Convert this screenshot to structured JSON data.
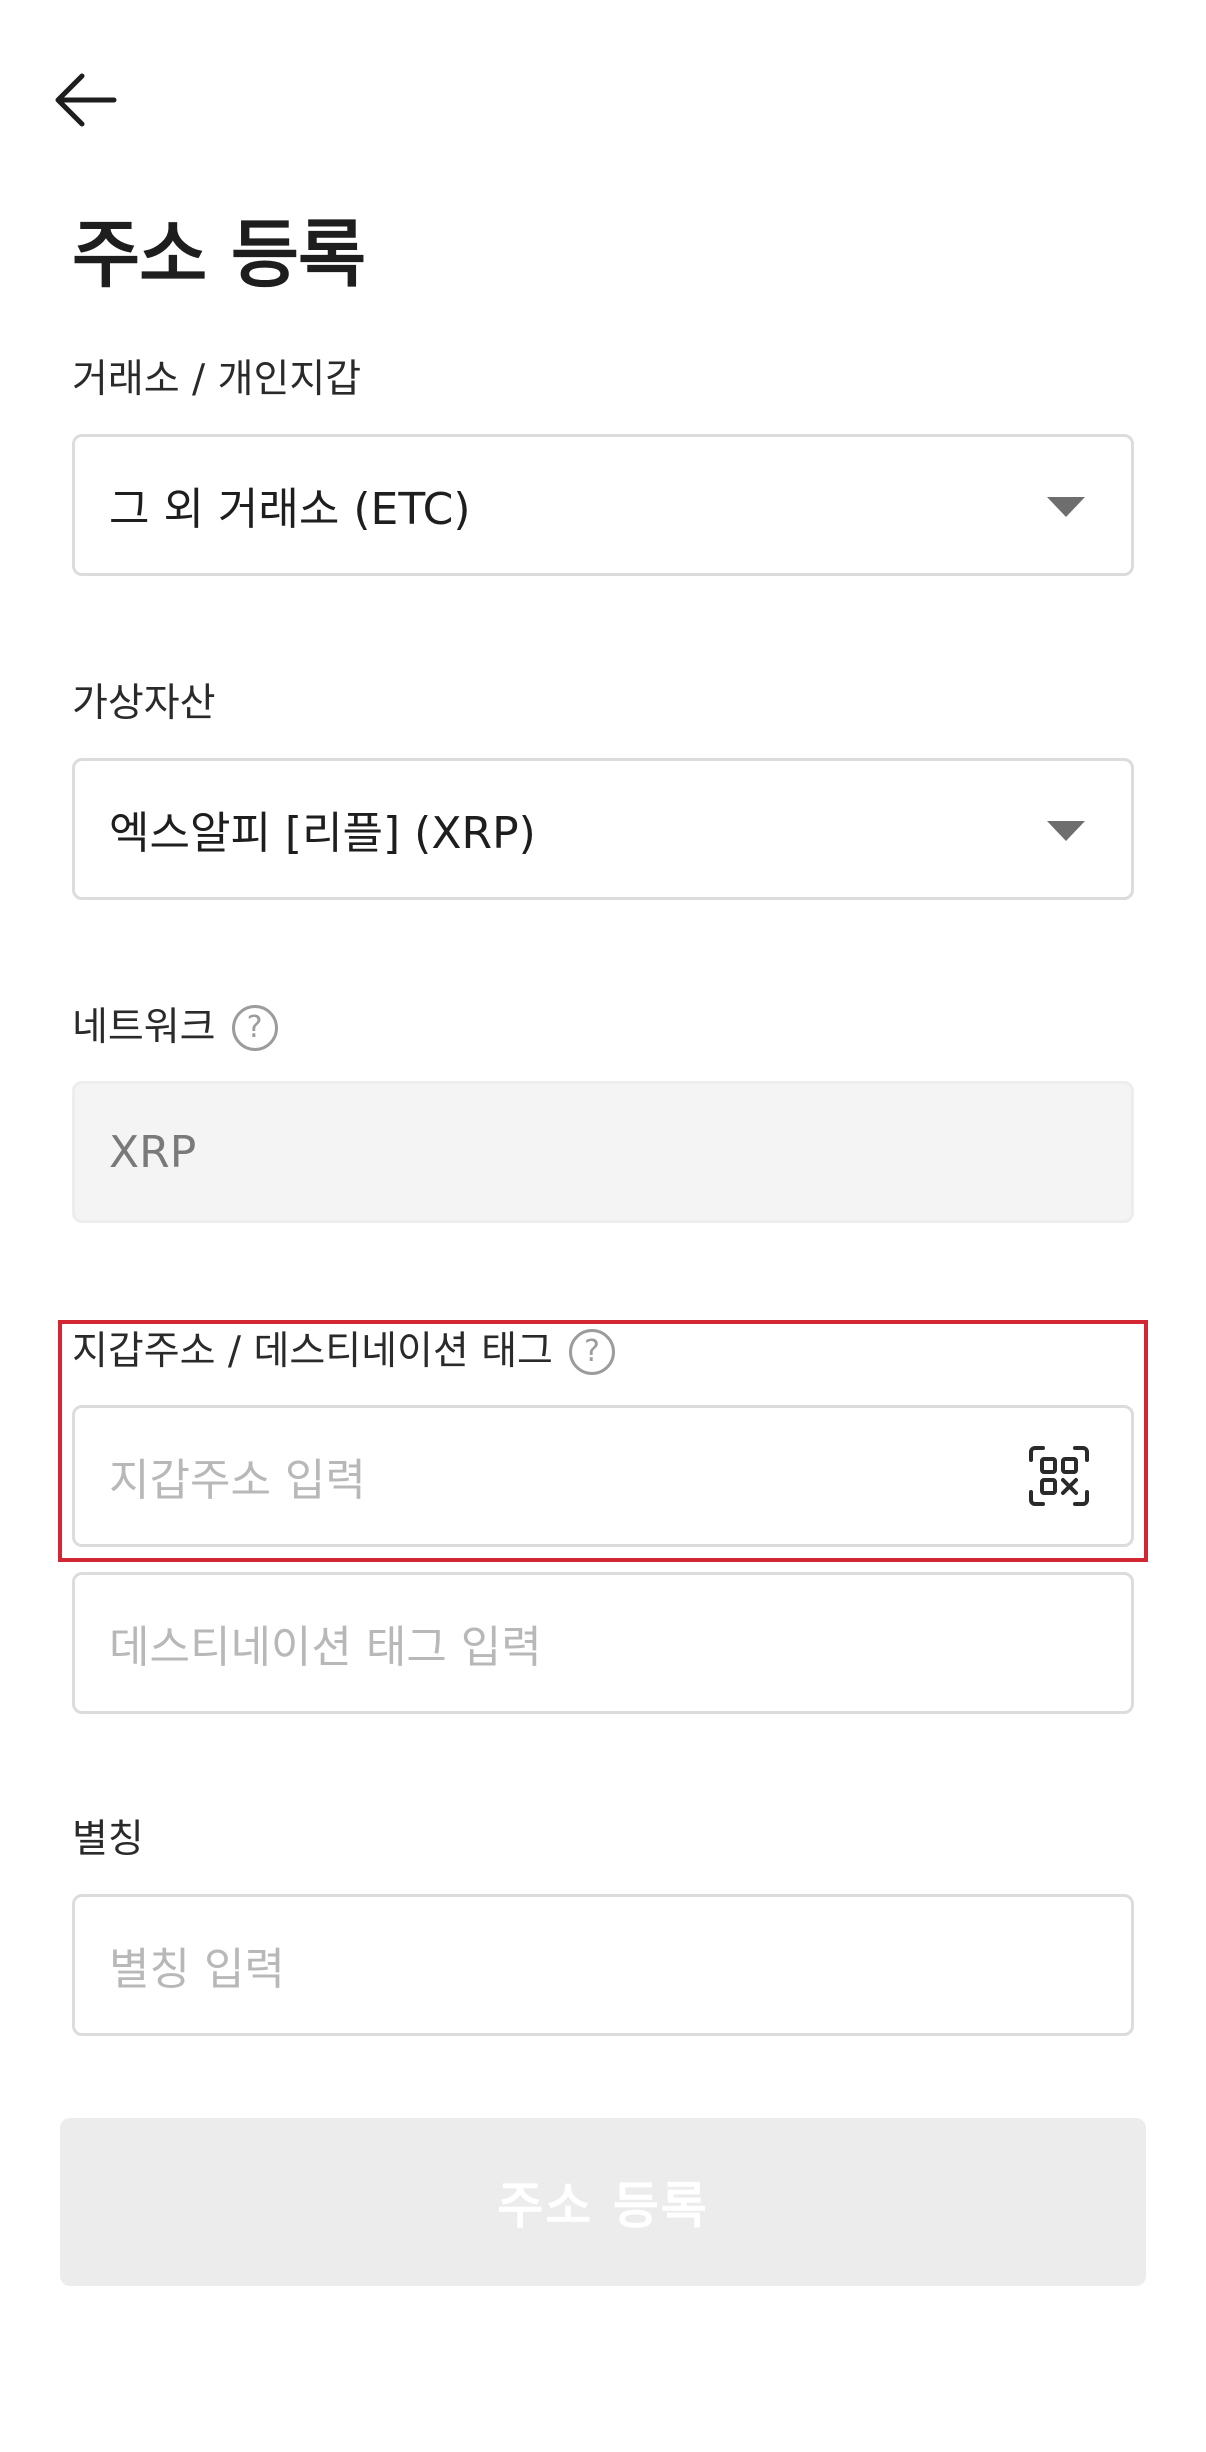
{
  "header": {
    "back_icon": "arrow-left-icon",
    "title": "주소 등록"
  },
  "exchange": {
    "label": "거래소 / 개인지갑",
    "value": "그 외 거래소 (ETC)",
    "icon": "caret-down-icon"
  },
  "asset": {
    "label": "가상자산",
    "value": "엑스알피 [리플] (XRP)",
    "icon": "caret-down-icon"
  },
  "network": {
    "label": "네트워크",
    "help_icon": "question-circle-icon",
    "help_glyph": "?",
    "value": "XRP"
  },
  "wallet": {
    "label": "지갑주소 / 데스티네이션 태그",
    "help_icon": "question-circle-icon",
    "help_glyph": "?",
    "address_placeholder": "지갑주소 입력",
    "qr_icon": "qr-scan-icon",
    "tag_placeholder": "데스티네이션 태그 입력"
  },
  "alias": {
    "label": "별칭",
    "placeholder": "별칭 입력"
  },
  "submit": {
    "label": "주소 등록"
  },
  "colors": {
    "highlight": "#d32733",
    "disabled_button_bg": "#ececec",
    "disabled_field_bg": "#f4f4f4",
    "border": "#dcdcdc"
  }
}
